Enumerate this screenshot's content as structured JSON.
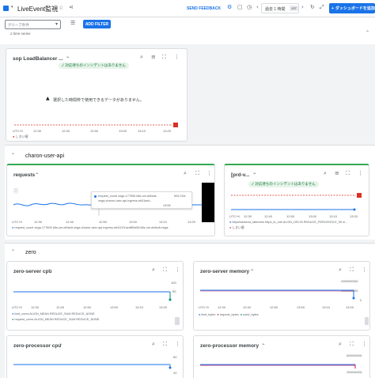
{
  "app": {
    "title": "LiveEvent監視",
    "send_feedback": "SEND FEEDBACK",
    "time_range": "過去 1 時間",
    "timezone": "JST",
    "dashboard_button": "ダッシュボードを追加"
  },
  "filters": {
    "group_placeholder": "グループ条件",
    "add_filter": "ADD FILTER"
  },
  "top_remnant": "2 time series",
  "lb_card": {
    "title": "sop LoadBalancer ...",
    "incident_chip": "対応待ちのインシデントはありません",
    "empty_message": "選択した時間枠で使用できるデータがありません。",
    "x_ticks": [
      "UTC+9",
      "12:30",
      "12:40",
      "12:50",
      "13:00",
      "13:10",
      "13:20"
    ],
    "legend": "しきい値"
  },
  "section_charon": {
    "title": "charon-user-api"
  },
  "requests_card": {
    "title": "requests",
    "tooltip_line1": "request_count vega-177606 k8s-um-default-",
    "tooltip_line2": "vega-charon-user-api-ingress-e641acb...",
    "tooltip_value": "504.23/s",
    "tooltip_time": "13:08",
    "x_ticks": [
      "UTC+9",
      "12:30",
      "12:40",
      "12:50",
      "13:00",
      "13:10",
      "13:20"
    ],
    "legend": "request_count vega-177606 k8s-um-default-vega-charon-user-api-ingress-e641021acdf80a58 k8s-um-default-vega-"
  },
  "prd_card": {
    "title": "[prd-v...",
    "incident_chip": "対応待ちのインシデントはありません",
    "x_ticks": [
      "UTC+9",
      "12:30",
      "12:40",
      "12:50",
      "13:00",
      "13:10",
      "13:20"
    ],
    "legend1": "https/backend_latencies https_lb_rule ALIGN_DELTA REDUCE_PERCENTILE_95 m...",
    "legend2": "しきい値"
  },
  "section_zero": {
    "title": "zero"
  },
  "zero_cpu": {
    "title": "zero-server cpu",
    "y_ticks": [
      "100",
      "50",
      "0"
    ],
    "x_ticks": [
      "UTC+9",
      "12:30",
      "12:40",
      "12:50",
      "13:00",
      "13:10",
      "13:20"
    ],
    "legend1": "limit_cores ALIGN_MEAN REDUCE_SUM REDUCE_NONE",
    "legend2": "request_cores ALIGN_MEAN REDUCE_SUM REDUCE_NONE"
  },
  "zero_mem": {
    "title": "zero-server memory",
    "y_ticks": [
      "20000000000",
      "10000000000",
      "0"
    ],
    "x_ticks": [
      "UTC+9",
      "12:30",
      "12:40",
      "12:50",
      "13:00",
      "13:10",
      "13:20"
    ],
    "legend": [
      "limit_bytes",
      "request_bytes",
      "used_bytes"
    ]
  },
  "zero_proc_cpu": {
    "title": "zero-processor cpu",
    "y_ticks": [
      "50",
      "20"
    ]
  },
  "zero_proc_mem": {
    "title": "zero-processor memory",
    "y_ticks": [
      "5000000000",
      "2000000000"
    ]
  },
  "colors": {
    "accent": "#1a73e8",
    "threshold": "#d93025",
    "green": "#137333",
    "teal_border": "#34a853"
  }
}
